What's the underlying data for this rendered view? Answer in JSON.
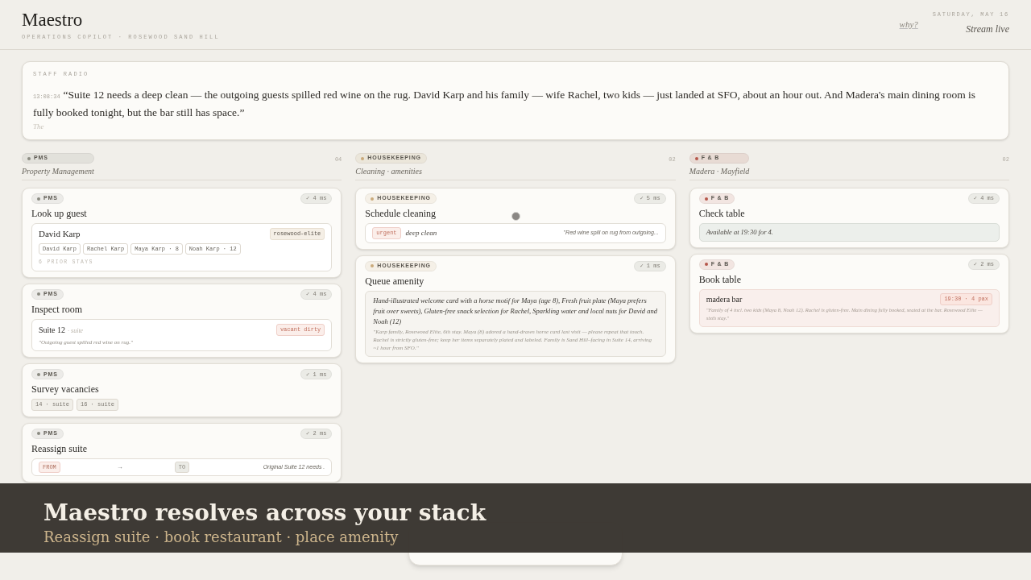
{
  "header": {
    "title": "Maestro",
    "subtitle": "OPERATIONS COPILOT · ROSEWOOD SAND HILL",
    "why_link": "why?",
    "date": "SATURDAY, MAY 16",
    "stream_status": "Stream live"
  },
  "radio": {
    "label": "STAFF RADIO",
    "time": "13:08:34",
    "transcript": "“Suite 12 needs a deep clean — the outgoing guests spilled red wine on the rug. David Karp and his family — wife Rachel, two kids — just landed at SFO, about an hour out. And Madera's main dining room is fully booked tonight, but the bar still has space.”",
    "partial": "The"
  },
  "columns": [
    {
      "tag": "PMS",
      "color": "#8a8a80",
      "subtitle": "Property Management",
      "count": "04",
      "cards": [
        {
          "kind": "guest",
          "tag": "PMS",
          "duration": "✓ 4 ms",
          "title": "Look up guest",
          "name": "David Karp",
          "tier": "rosewood-elite",
          "party": [
            "David Karp",
            "Rachel Karp",
            "Maya Karp · 8",
            "Noah Karp · 12"
          ],
          "stays": "6 PRIOR STAYS"
        },
        {
          "kind": "room",
          "tag": "PMS",
          "duration": "✓ 4 ms",
          "title": "Inspect room",
          "room": "Suite 12",
          "room_type": "· suite",
          "status": "vacant dirty",
          "note": "\"Outgoing guest spilled red wine on rug.\""
        },
        {
          "kind": "vacancies",
          "tag": "PMS",
          "duration": "✓ 1 ms",
          "title": "Survey vacancies",
          "rooms": [
            "14 · suite",
            "16 · suite"
          ]
        },
        {
          "kind": "reassign",
          "tag": "PMS",
          "duration": "✓ 2 ms",
          "title": "Reassign suite",
          "from": "FROM",
          "arrow": "→",
          "to": "TO",
          "note": "Original Suite 12 needs ."
        }
      ]
    },
    {
      "tag": "HOUSEKEEPING",
      "color": "#c9a97a",
      "subtitle": "Cleaning · amenities",
      "count": "02",
      "cards": [
        {
          "kind": "cleaning",
          "tag": "HOUSEKEEPING",
          "duration": "✓ 5 ms",
          "title": "Schedule cleaning",
          "priority": "urgent",
          "task": "deep clean",
          "note": "\"Red wine spill on rug from outgoing...",
          "busy": true
        },
        {
          "kind": "amenity",
          "tag": "HOUSEKEEPING",
          "duration": "✓ 1 ms",
          "title": "Queue amenity",
          "items": "Hand-illustrated welcome card with a horse motif for Maya (age 8), Fresh fruit plate (Maya prefers fruit over sweets), Gluten-free snack selection for Rachel, Sparkling water and local nuts for David and Noah (12)",
          "note": "\"Karp family, Rosewood Elite, 6th stay. Maya (8) adored a hand-drawn horse card last visit — please repeat that touch. Rachel is strictly gluten-free; keep her items separately plated and labeled. Family is Sand Hill–facing in Suite 14, arriving ~1 hour from SFO.\""
        }
      ]
    },
    {
      "tag": "F & B",
      "color": "#b5574a",
      "subtitle": "Madera · Mayfield",
      "count": "02",
      "cards": [
        {
          "kind": "availability",
          "tag": "F & B",
          "duration": "✓ 4 ms",
          "title": "Check table",
          "result": "Available at 19:30 for 4."
        },
        {
          "kind": "booking",
          "tag": "F & B",
          "duration": "✓ 2 ms",
          "title": "Book table",
          "venue": "madera bar",
          "slot": "19:30 · 4 pax",
          "note": "\"Family of 4 incl. two kids (Maya 8, Noah 12). Rachel is gluten-free. Main dining fully booked, seated at the bar. Rosewood Elite — sixth stay.\""
        }
      ]
    }
  ],
  "caption": {
    "title": "Maestro resolves across your stack",
    "subtitle": "Reassign suite · book restaurant · place amenity"
  }
}
